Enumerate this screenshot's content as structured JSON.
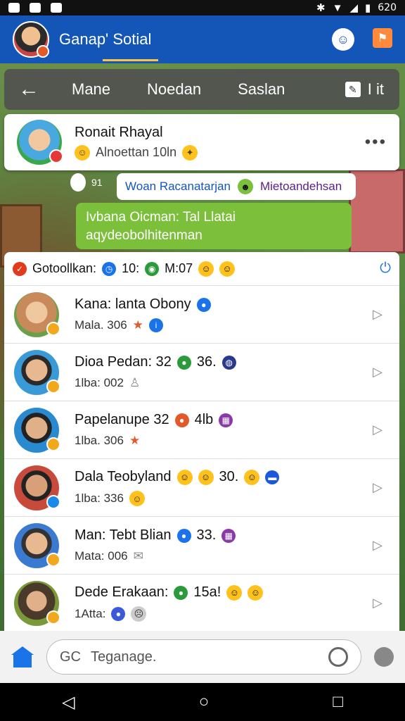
{
  "status_bar": {
    "time": "620"
  },
  "app": {
    "title": "Ganap' Sotial"
  },
  "tabs": {
    "items": [
      "Mane",
      "Noedan",
      "Saslan"
    ],
    "edit_label": "I it"
  },
  "profile": {
    "name": "Ronait Rhayal",
    "status": "Alnoettan 10ln"
  },
  "chat": {
    "small_text": "91",
    "bubble_left": "Woan Racanatarjan",
    "bubble_right": "Mietoandehsan",
    "green_line1": "Ivbana Oicman: Tal Llatai",
    "green_line2": "aqydeobolhitenman"
  },
  "panel": {
    "header_label": "Gotoollkan:",
    "header_stat1": "10:",
    "header_stat2": "M:07"
  },
  "rows": [
    {
      "name": "Kana: lanta Obony",
      "sub": "Mala. 306",
      "avatar_color": "#c88a5a"
    },
    {
      "name": "Dioa Pedan: 32",
      "extra": "36.",
      "sub": "1lba: 002",
      "avatar_color": "#3a9ad8"
    },
    {
      "name": "Papelanupe 32",
      "extra": "4lb",
      "sub": "1lba. 306",
      "avatar_color": "#2a8ad0"
    },
    {
      "name": "Dala Teobyland",
      "extra": "30.",
      "sub": "1lba: 336",
      "avatar_color": "#c84a3a"
    },
    {
      "name": "Man: Tebt Blian",
      "extra": "33.",
      "sub": "Mata: 006",
      "avatar_color": "#3a7ad0"
    },
    {
      "name": "Dede Erakaan:",
      "extra": "15a!",
      "sub": "1Atta:",
      "avatar_color": "#7a9a3a"
    }
  ],
  "input": {
    "prefix": "GC",
    "placeholder": "Teganage."
  }
}
